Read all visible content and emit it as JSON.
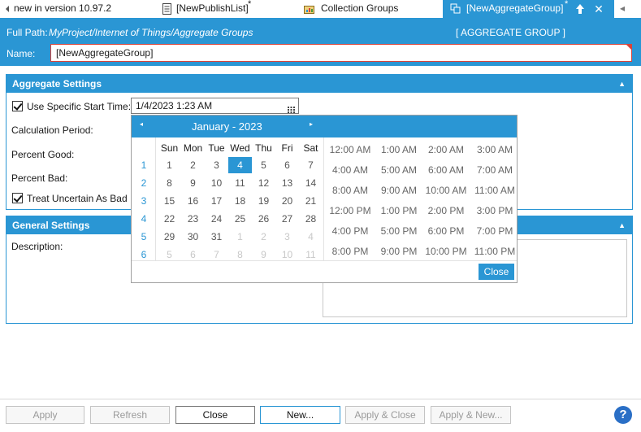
{
  "tabs": [
    {
      "label": "new in version 10.97.2",
      "icon": "back-arrow-icon",
      "modified": false,
      "active": false
    },
    {
      "label": "[NewPublishList]",
      "icon": "document-icon",
      "modified": true,
      "active": false
    },
    {
      "label": "Collection Groups",
      "icon": "folder-chart-icon",
      "modified": false,
      "active": false
    },
    {
      "label": "[NewAggregateGroup]",
      "icon": "group-icon",
      "modified": true,
      "active": true
    }
  ],
  "tab_modified_mark": "*",
  "tab_controls": {
    "pin": "⇧",
    "close": "✕",
    "scroll": "◂"
  },
  "header": {
    "full_path_label": "Full Path:",
    "full_path_value": "MyProject/Internet of Things/Aggregate Groups",
    "type_label": "[ AGGREGATE GROUP ]",
    "name_label": "Name:",
    "name_value": "[NewAggregateGroup]"
  },
  "aggregate_settings": {
    "title": "Aggregate Settings",
    "use_specific_start_time_label": "Use Specific Start Time:",
    "use_specific_start_time_checked": true,
    "start_time_value": "1/4/2023 1:23 AM",
    "calculation_period_label": "Calculation Period:",
    "percent_good_label": "Percent Good:",
    "percent_bad_label": "Percent Bad:",
    "treat_uncertain_label": "Treat Uncertain As Bad",
    "treat_uncertain_checked": true
  },
  "general_settings": {
    "title": "General Settings",
    "description_label": "Description:"
  },
  "date_picker": {
    "month_label": "January - 2023",
    "prev": "◂",
    "next": "▸",
    "weekdays": [
      "Sun",
      "Mon",
      "Tue",
      "Wed",
      "Thu",
      "Fri",
      "Sat"
    ],
    "week_numbers": [
      "1",
      "2",
      "3",
      "4",
      "5",
      "6"
    ],
    "weeks": [
      [
        "1",
        "2",
        "3",
        "4",
        "5",
        "6",
        "7"
      ],
      [
        "8",
        "9",
        "10",
        "11",
        "12",
        "13",
        "14"
      ],
      [
        "15",
        "16",
        "17",
        "18",
        "19",
        "20",
        "21"
      ],
      [
        "22",
        "23",
        "24",
        "25",
        "26",
        "27",
        "28"
      ],
      [
        "29",
        "30",
        "31",
        "1",
        "2",
        "3",
        "4"
      ],
      [
        "5",
        "6",
        "7",
        "8",
        "9",
        "10",
        "11"
      ]
    ],
    "selected_day": "4",
    "times": [
      [
        "12:00 AM",
        "1:00 AM",
        "2:00 AM",
        "3:00 AM"
      ],
      [
        "4:00 AM",
        "5:00 AM",
        "6:00 AM",
        "7:00 AM"
      ],
      [
        "8:00 AM",
        "9:00 AM",
        "10:00 AM",
        "11:00 AM"
      ],
      [
        "12:00 PM",
        "1:00 PM",
        "2:00 PM",
        "3:00 PM"
      ],
      [
        "4:00 PM",
        "5:00 PM",
        "6:00 PM",
        "7:00 PM"
      ],
      [
        "8:00 PM",
        "9:00 PM",
        "10:00 PM",
        "11:00 PM"
      ]
    ],
    "close_label": "Close"
  },
  "buttons": {
    "apply": "Apply",
    "refresh": "Refresh",
    "close": "Close",
    "new": "New...",
    "apply_close": "Apply & Close",
    "apply_new": "Apply & New..."
  },
  "help_label": "?",
  "colors": {
    "accent": "#2a96d4",
    "error_border": "#d9443a",
    "help": "#2a6fc6"
  }
}
